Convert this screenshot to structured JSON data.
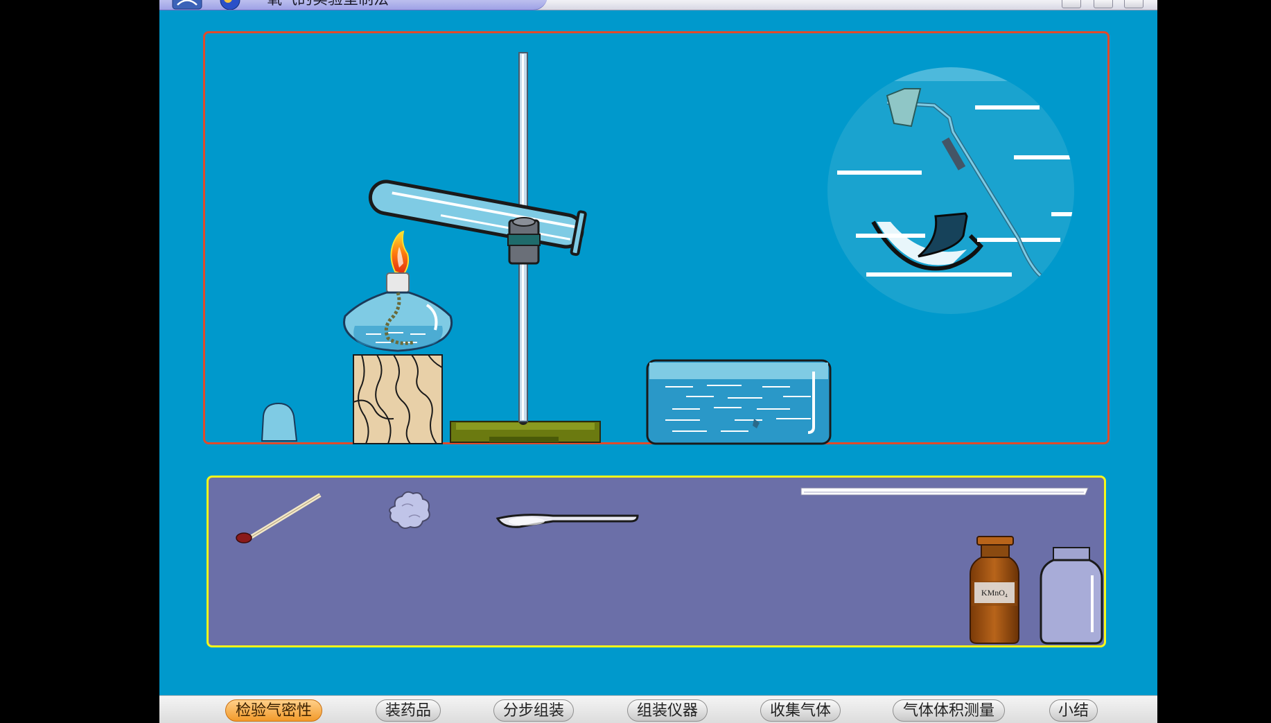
{
  "window": {
    "title": "氧气的实验室制法"
  },
  "reagent": {
    "label": "KMnO₄"
  },
  "nav": {
    "buttons": [
      {
        "label": "检验气密性",
        "active": true
      },
      {
        "label": "装药品",
        "active": false
      },
      {
        "label": "分步组装",
        "active": false
      },
      {
        "label": "组装仪器",
        "active": false
      },
      {
        "label": "收集气体",
        "active": false
      },
      {
        "label": "气体体积测量",
        "active": false
      },
      {
        "label": "小结",
        "active": false
      }
    ]
  },
  "colors": {
    "background": "#0099cc",
    "apparatus_border": "#e24a2a",
    "tools_border": "#f7f71a",
    "tools_fill": "#6b6fa8",
    "active_button": "#f29a2a"
  },
  "icons": {
    "apparatus": [
      "test-tube-icon",
      "iron-stand-icon",
      "alcohol-lamp-icon",
      "wooden-block-icon",
      "lamp-cap-icon",
      "water-trough-icon",
      "magnified-view-icon"
    ],
    "tools": [
      "match-icon",
      "cotton-icon",
      "spoon-icon",
      "glass-rod-icon",
      "kmno4-bottle-icon",
      "gas-bottle-icon"
    ]
  }
}
